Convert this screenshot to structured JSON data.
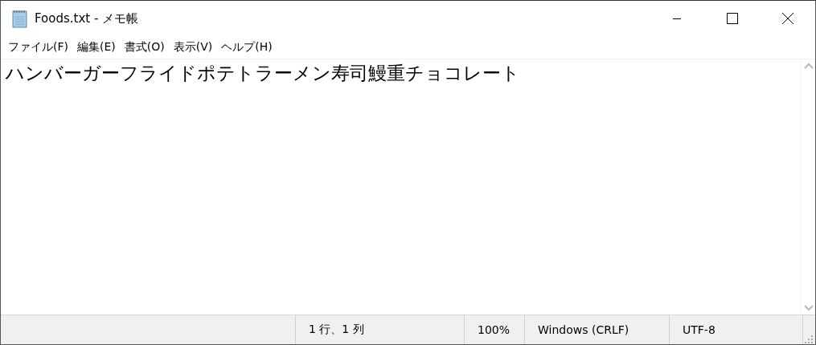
{
  "window": {
    "title": "Foods.txt - メモ帳"
  },
  "menu": [
    {
      "label": "ファイル(F)"
    },
    {
      "label": "編集(E)"
    },
    {
      "label": "書式(O)"
    },
    {
      "label": "表示(V)"
    },
    {
      "label": "ヘルプ(H)"
    }
  ],
  "editor": {
    "value": "ハンバーガーフライドポテトラーメン寿司鰻重チョコレート"
  },
  "status_bar": [
    "1 行、1 列",
    "100%",
    "Windows (CRLF)",
    "UTF-8"
  ]
}
